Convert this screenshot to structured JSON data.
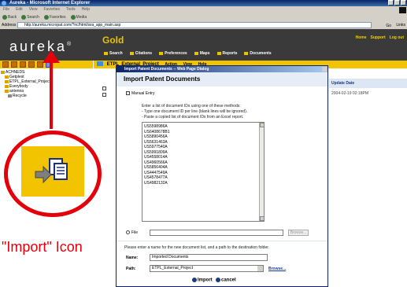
{
  "browser": {
    "title": "Aureka - Microsoft Internet Explorer",
    "menu": [
      "File",
      "Edit",
      "View",
      "Favorites",
      "Tools",
      "Help"
    ],
    "toolbar": [
      "Back",
      "Search",
      "Favorites",
      "Media"
    ],
    "address_label": "Address",
    "address_value": "http://aureka.micropat.com/?nc/html/ara_app_main.asp",
    "go_label": "Go",
    "links_label": "Links"
  },
  "app": {
    "brand": "aureka",
    "brand_mark": "®",
    "edition": "Gold",
    "header_links": [
      "Home",
      "Support",
      "Log out"
    ],
    "nav": [
      "Search",
      "Citations",
      "Preferences",
      "Maps",
      "Reports",
      "Documents"
    ]
  },
  "tree": {
    "items": [
      "ACHNEDS",
      "Getplest",
      "ETPL_External_Project",
      "Everybody",
      "antenna",
      "Recycle"
    ]
  },
  "project": {
    "title": "ETPL_External_Project",
    "menu": [
      "Action",
      "View",
      "Help"
    ]
  },
  "update": {
    "header": "Update Date",
    "value": "2004-02-19 02:18PM"
  },
  "dialog": {
    "window_title": "Import Patent Documents -- Web Page Dialog",
    "heading": "Import Patent Documents",
    "manual_entry": "Manual Entry",
    "instructions": [
      "Enter a list of document IDs using one of these methods:",
      "- Type one document ID per line (blank lines will be ignored).",
      "- Paste a copied list of document IDs from an Excel report."
    ],
    "document_ids": [
      "US5598986A",
      "US6408678B1",
      "US5890456A",
      "US5631463A",
      "US5977540A",
      "US5991809A",
      "US4558014A",
      "US4960566A",
      "US5856404A",
      "US4447549A",
      "US4578477A",
      "US4982132A"
    ],
    "file_label": "File",
    "browse_disabled": "Browse...",
    "prompt": "Please enter a name for the new document list, and a path to the destination folder.",
    "name_label": "Name:",
    "name_value": "Imported Documents",
    "path_label": "Path:",
    "path_value": "ETPL_External_Project",
    "browse_link": "Browse...",
    "import_label": "Import",
    "cancel_label": "cancel"
  },
  "annotation": {
    "text": "\"Import\" Icon",
    "color": "#e3000b"
  }
}
